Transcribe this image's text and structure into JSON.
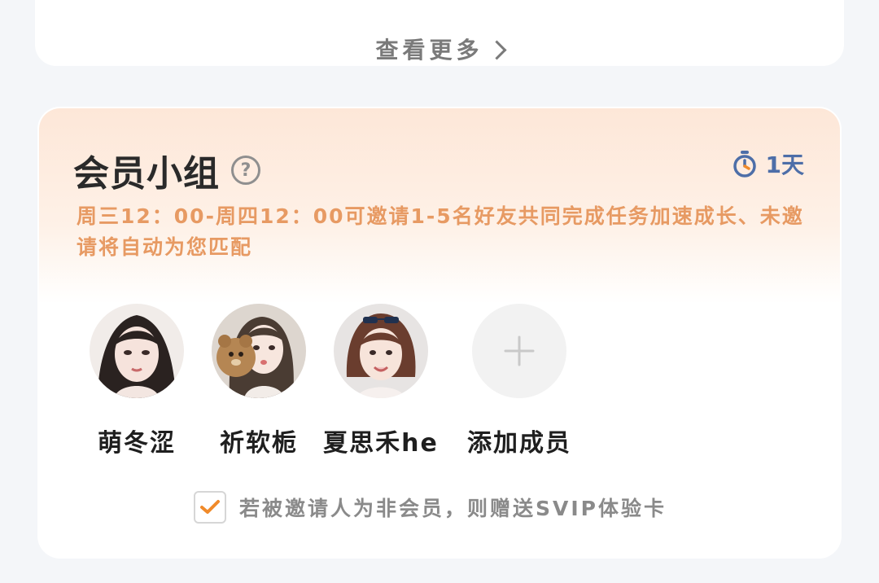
{
  "top_card": {
    "see_more_label": "查看更多"
  },
  "group": {
    "title": "会员小组",
    "timer_text": "1天",
    "description": "周三12：00-周四12：00可邀请1-5名好友共同完成任务加速成长、未邀请将自动为您匹配",
    "members": [
      {
        "name": "萌冬涩"
      },
      {
        "name": "祈软栀"
      },
      {
        "name": "夏思禾he"
      }
    ],
    "add_member_label": "添加成员",
    "consent_text": "若被邀请人为非会员，则赠送SVIP体验卡",
    "consent_checked": true
  },
  "colors": {
    "accent": "#f08a2a",
    "timer": "#4d6ea8",
    "description": "#e79a63"
  }
}
